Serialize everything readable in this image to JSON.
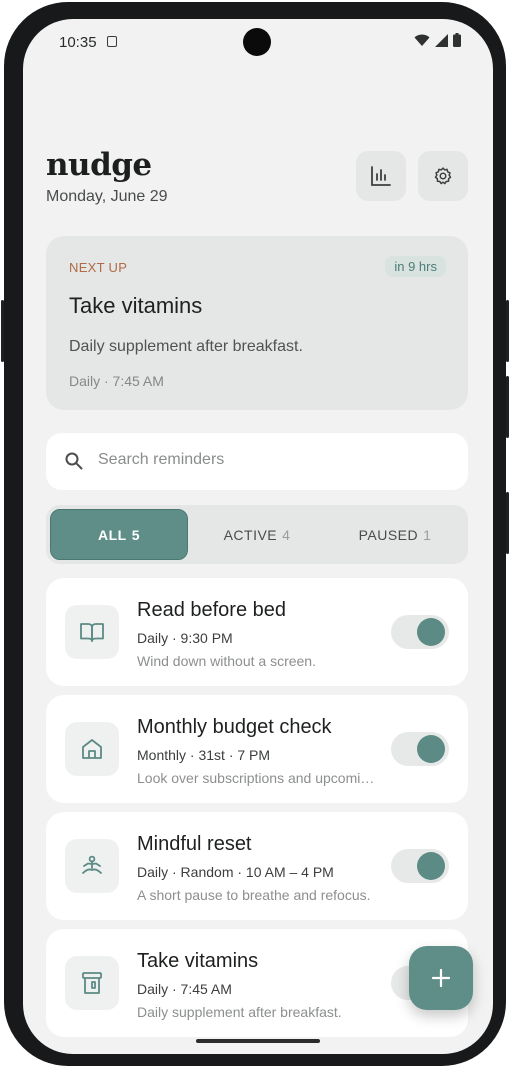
{
  "status": {
    "time": "10:35"
  },
  "header": {
    "app_name": "nudge",
    "date": "Monday, June 29"
  },
  "next_up": {
    "label": "NEXT UP",
    "badge": "in 9 hrs",
    "title": "Take vitamins",
    "description": "Daily supplement after breakfast.",
    "schedule": "Daily · 7:45 AM"
  },
  "search": {
    "placeholder": "Search reminders"
  },
  "tabs": [
    {
      "label": "ALL",
      "count": "5",
      "active": true
    },
    {
      "label": "ACTIVE",
      "count": "4",
      "active": false
    },
    {
      "label": "PAUSED",
      "count": "1",
      "active": false
    }
  ],
  "reminders": [
    {
      "icon": "book-icon",
      "title": "Read before bed",
      "schedule": "Daily · 9:30 PM",
      "description": "Wind down without a screen.",
      "enabled": true
    },
    {
      "icon": "home-icon",
      "title": "Monthly budget check",
      "schedule": "Monthly · 31st · 7 PM",
      "description": "Look over subscriptions and upcoming bills.",
      "enabled": true
    },
    {
      "icon": "meditation-icon",
      "title": "Mindful reset",
      "schedule": "Daily · Random · 10 AM – 4 PM",
      "description": "A short pause to breathe and refocus.",
      "enabled": true
    },
    {
      "icon": "pill-bottle-icon",
      "title": "Take vitamins",
      "schedule": "Daily · 7:45 AM",
      "description": "Daily supplement after breakfast.",
      "enabled": true
    }
  ],
  "fab": {
    "label": "+"
  },
  "colors": {
    "accent": "#5f8e89",
    "next_label": "#b06a46",
    "background": "#f1f2f1"
  }
}
